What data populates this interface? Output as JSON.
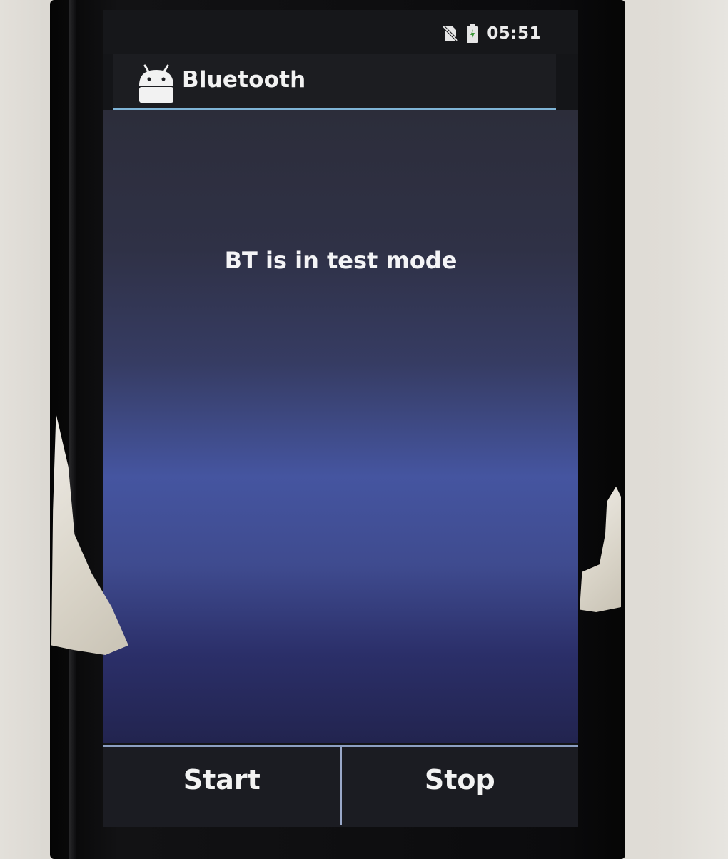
{
  "status_bar": {
    "time": "05:51",
    "icons": [
      "no-sim-icon",
      "battery-charging-icon"
    ]
  },
  "action_bar": {
    "app_icon": "android-icon",
    "title": "Bluetooth"
  },
  "content": {
    "message": "BT is in test mode"
  },
  "buttons": {
    "start_label": "Start",
    "stop_label": "Stop"
  },
  "colors": {
    "accent_divider": "#7fb4d6",
    "content_gradient_mid": "#4555a0"
  }
}
